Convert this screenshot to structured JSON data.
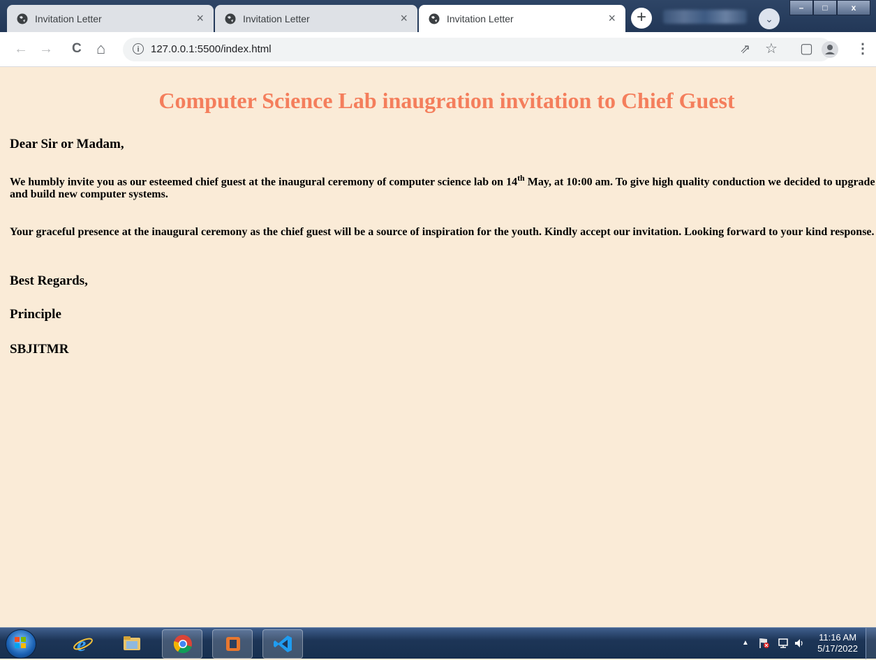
{
  "browser": {
    "tabs": [
      {
        "title": "Invitation Letter",
        "active": false
      },
      {
        "title": "Invitation Letter",
        "active": false
      },
      {
        "title": "Invitation Letter",
        "active": true
      }
    ],
    "new_tab_label": "+",
    "url": "127.0.0.1:5500/index.html",
    "icons": {
      "back": "←",
      "forward": "→",
      "reload": "C",
      "home": "⌂",
      "share": "⇗",
      "star": "☆",
      "sidebar": "▢",
      "menu": "⋮",
      "close": "×",
      "profile_dropdown": "⌄"
    },
    "window_buttons": {
      "minimize": "–",
      "maximize": "□",
      "close": "x"
    }
  },
  "letter": {
    "title": "Computer Science Lab inaugration invitation to Chief Guest",
    "salutation": "Dear Sir or Madam,",
    "para1_pre": "We humbly invite you as our esteemed chief guest at the inaugural ceremony of computer science lab on 14",
    "para1_sup": "th",
    "para1_post": " May, at 10:00 am. To give high quality conduction we decided to upgrade and build new computer systems.",
    "para2": "Your graceful presence at the inaugural ceremony as the chief guest will be a source of inspiration for the youth. Kindly accept our invitation. Looking forward to your kind response.",
    "closing": "Best Regards,",
    "signature_role": "Principle",
    "signature_org": "SBJITMR"
  },
  "taskbar": {
    "time": "11:16 AM",
    "date": "5/17/2022",
    "tray_arrow": "▲"
  },
  "colors": {
    "page_background": "#faebd7",
    "title_color": "#f47e5c"
  }
}
